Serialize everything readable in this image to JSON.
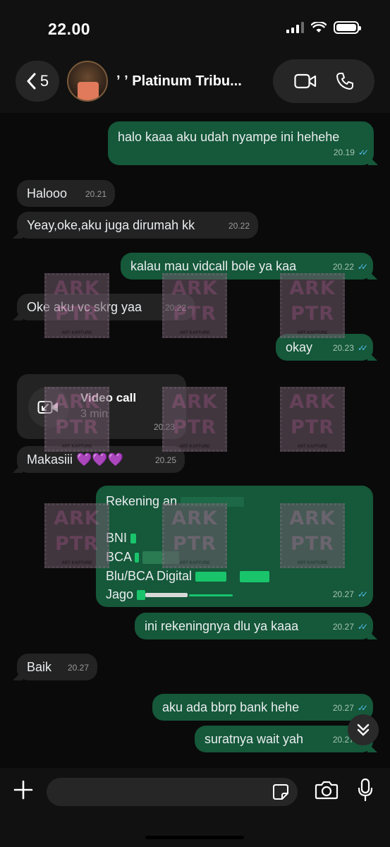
{
  "status_bar": {
    "time": "22.00"
  },
  "header": {
    "back_count": "5",
    "contact_name": "ʼ ʼ Platinum Tribu...",
    "icons": {
      "back": "chevron-left-icon",
      "video": "video-camera-icon",
      "call": "phone-icon"
    }
  },
  "messages": [
    {
      "direction": "out",
      "text": "halo kaaa aku udah nyampe ini hehehe",
      "time": "20.19",
      "read": true
    },
    {
      "direction": "in",
      "text": "Halooo",
      "time": "20.21"
    },
    {
      "direction": "in",
      "text": "Yeay,oke,aku juga dirumah kk",
      "time": "20.22"
    },
    {
      "direction": "out",
      "text": "kalau mau vidcall bole ya kaa",
      "time": "20.22",
      "read": true
    },
    {
      "direction": "in",
      "text": "Oke aku vc skrg yaa",
      "time": "20.22"
    },
    {
      "direction": "out",
      "text": "okay",
      "time": "20.23",
      "read": true
    },
    {
      "direction": "in",
      "type": "call",
      "title": "Video call",
      "subtitle": "3 min",
      "time": "20.23",
      "icon": "missed-video-call-icon"
    },
    {
      "direction": "in",
      "text": "Makasiii 💜💜💜",
      "time": "20.25"
    },
    {
      "direction": "out",
      "type": "bank",
      "lines": [
        "Rekening an",
        "BNI",
        "BCA",
        "Blu/BCA Digital",
        "Jago"
      ],
      "time": "20.27",
      "read": true
    },
    {
      "direction": "out",
      "text": "ini rekeningnya dlu ya kaaa",
      "time": "20.27",
      "read": true
    },
    {
      "direction": "in",
      "text": "Baik",
      "time": "20.27"
    },
    {
      "direction": "out",
      "text": "aku ada bbrp bank hehe",
      "time": "20.27",
      "read": true
    },
    {
      "direction": "out",
      "text": "suratnya wait yah",
      "time": "20.27",
      "read": true
    }
  ],
  "watermark": {
    "line1": "ARK",
    "line2": "PTR",
    "line3": "ART KAPTURE"
  },
  "composer": {
    "placeholder": "",
    "icons": {
      "add": "plus-icon",
      "sticker": "sticker-icon",
      "camera": "camera-icon",
      "mic": "microphone-icon",
      "scroll": "chevron-double-down-icon"
    }
  },
  "colors": {
    "outgoing_bubble": "#15583a",
    "incoming_bubble": "#232323",
    "read_ticks": "#53bdeb",
    "background": "#0a0a0a"
  }
}
